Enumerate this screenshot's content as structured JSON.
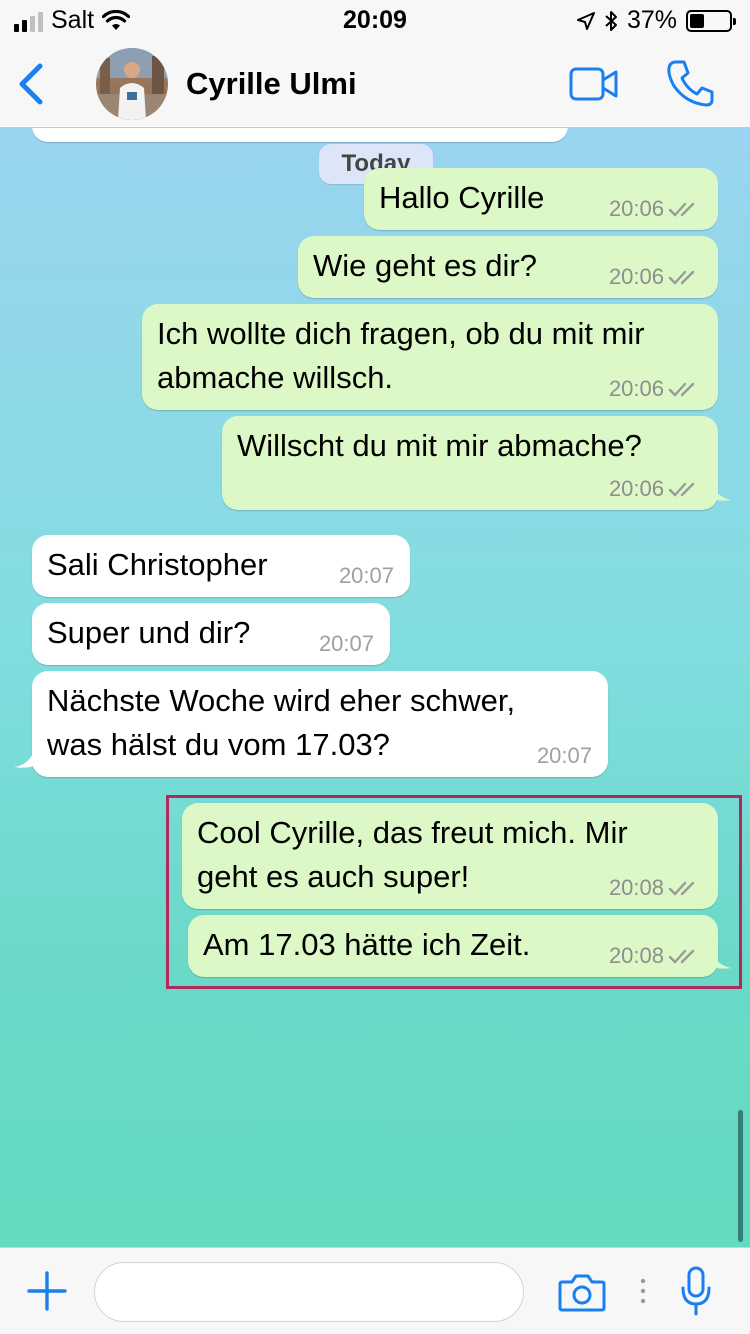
{
  "status_bar": {
    "carrier": "Salt",
    "time": "20:09",
    "battery": "37%",
    "battery_level": 0.37,
    "signal_bars": 2
  },
  "header": {
    "contact_name": "Cyrille Ulmi",
    "back_icon": "chevron-left-icon",
    "video_icon": "video-camera-icon",
    "call_icon": "phone-icon"
  },
  "chat": {
    "date_label": "Today",
    "messages": [
      {
        "direction": "out",
        "text": "Hallo Cyrille",
        "time": "20:06",
        "status": "read"
      },
      {
        "direction": "out",
        "text": "Wie geht es dir?",
        "time": "20:06",
        "status": "read"
      },
      {
        "direction": "out",
        "text": "Ich wollte dich fragen, ob du mit mir\nabmache willsch.",
        "time": "20:06",
        "status": "read"
      },
      {
        "direction": "out",
        "text": "Willscht du mit mir abmache?",
        "time": "20:06",
        "status": "read"
      },
      {
        "direction": "in",
        "text": "Sali Christopher",
        "time": "20:07"
      },
      {
        "direction": "in",
        "text": "Super und dir?",
        "time": "20:07"
      },
      {
        "direction": "in",
        "text": "Nächste Woche wird eher schwer,\nwas hälst du vom 17.03?",
        "time": "20:07"
      },
      {
        "direction": "out",
        "text": "Cool Cyrille, das freut mich. Mir\ngeht es auch super!",
        "time": "20:08",
        "status": "read"
      },
      {
        "direction": "out",
        "text": "Am 17.03 hätte ich Zeit.",
        "time": "20:08",
        "status": "read"
      }
    ]
  },
  "input_bar": {
    "placeholder": "",
    "value": ""
  },
  "colors": {
    "accent": "#1a7ff0",
    "outgoing_bubble": "#dcf8c6",
    "incoming_bubble": "#ffffff",
    "highlight_border": "#b02a5e"
  }
}
